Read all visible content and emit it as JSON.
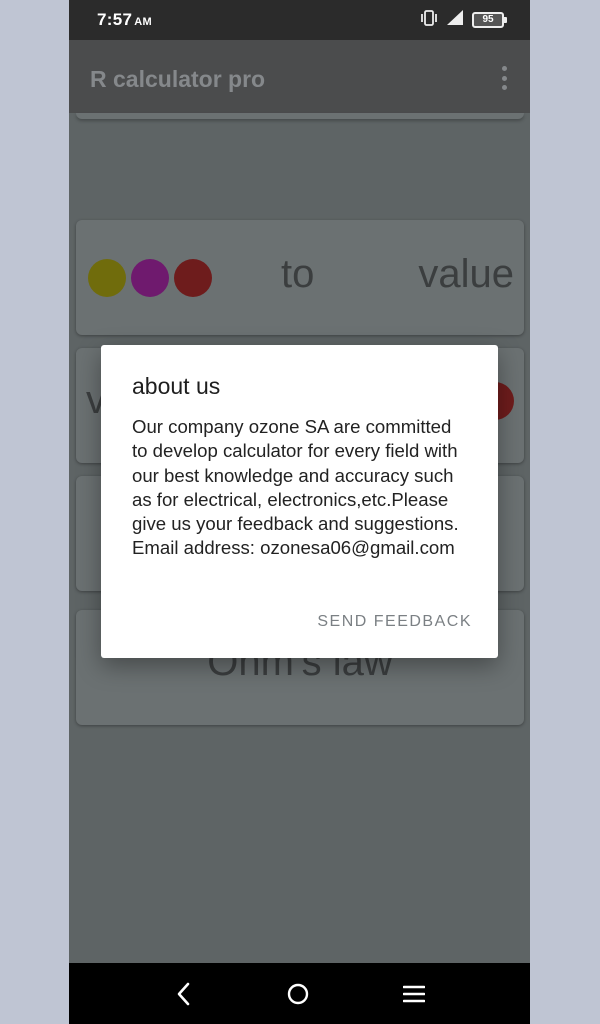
{
  "status_bar": {
    "time": "7:57",
    "ampm": "AM",
    "battery": "95"
  },
  "app_bar": {
    "title": "R calculator pro"
  },
  "cards": {
    "color_to_value": {
      "to": "to",
      "value": "value"
    },
    "value_to_color": {
      "partial": "v"
    },
    "ohms_law": {
      "label": "Ohm's law"
    }
  },
  "dialog": {
    "title": "about us",
    "body": "Our company ozone SA are committed to develop calculator for every field with our best knowledge and accuracy such as for electrical, electronics,etc.Please give us your feedback and suggestions. Email address: ozonesa06@gmail.com",
    "action": "SEND FEEDBACK"
  },
  "colors": {
    "accent_overlay": "#5e6465",
    "dialog_bg": "#ffffff",
    "action_text": "#7b8084"
  }
}
